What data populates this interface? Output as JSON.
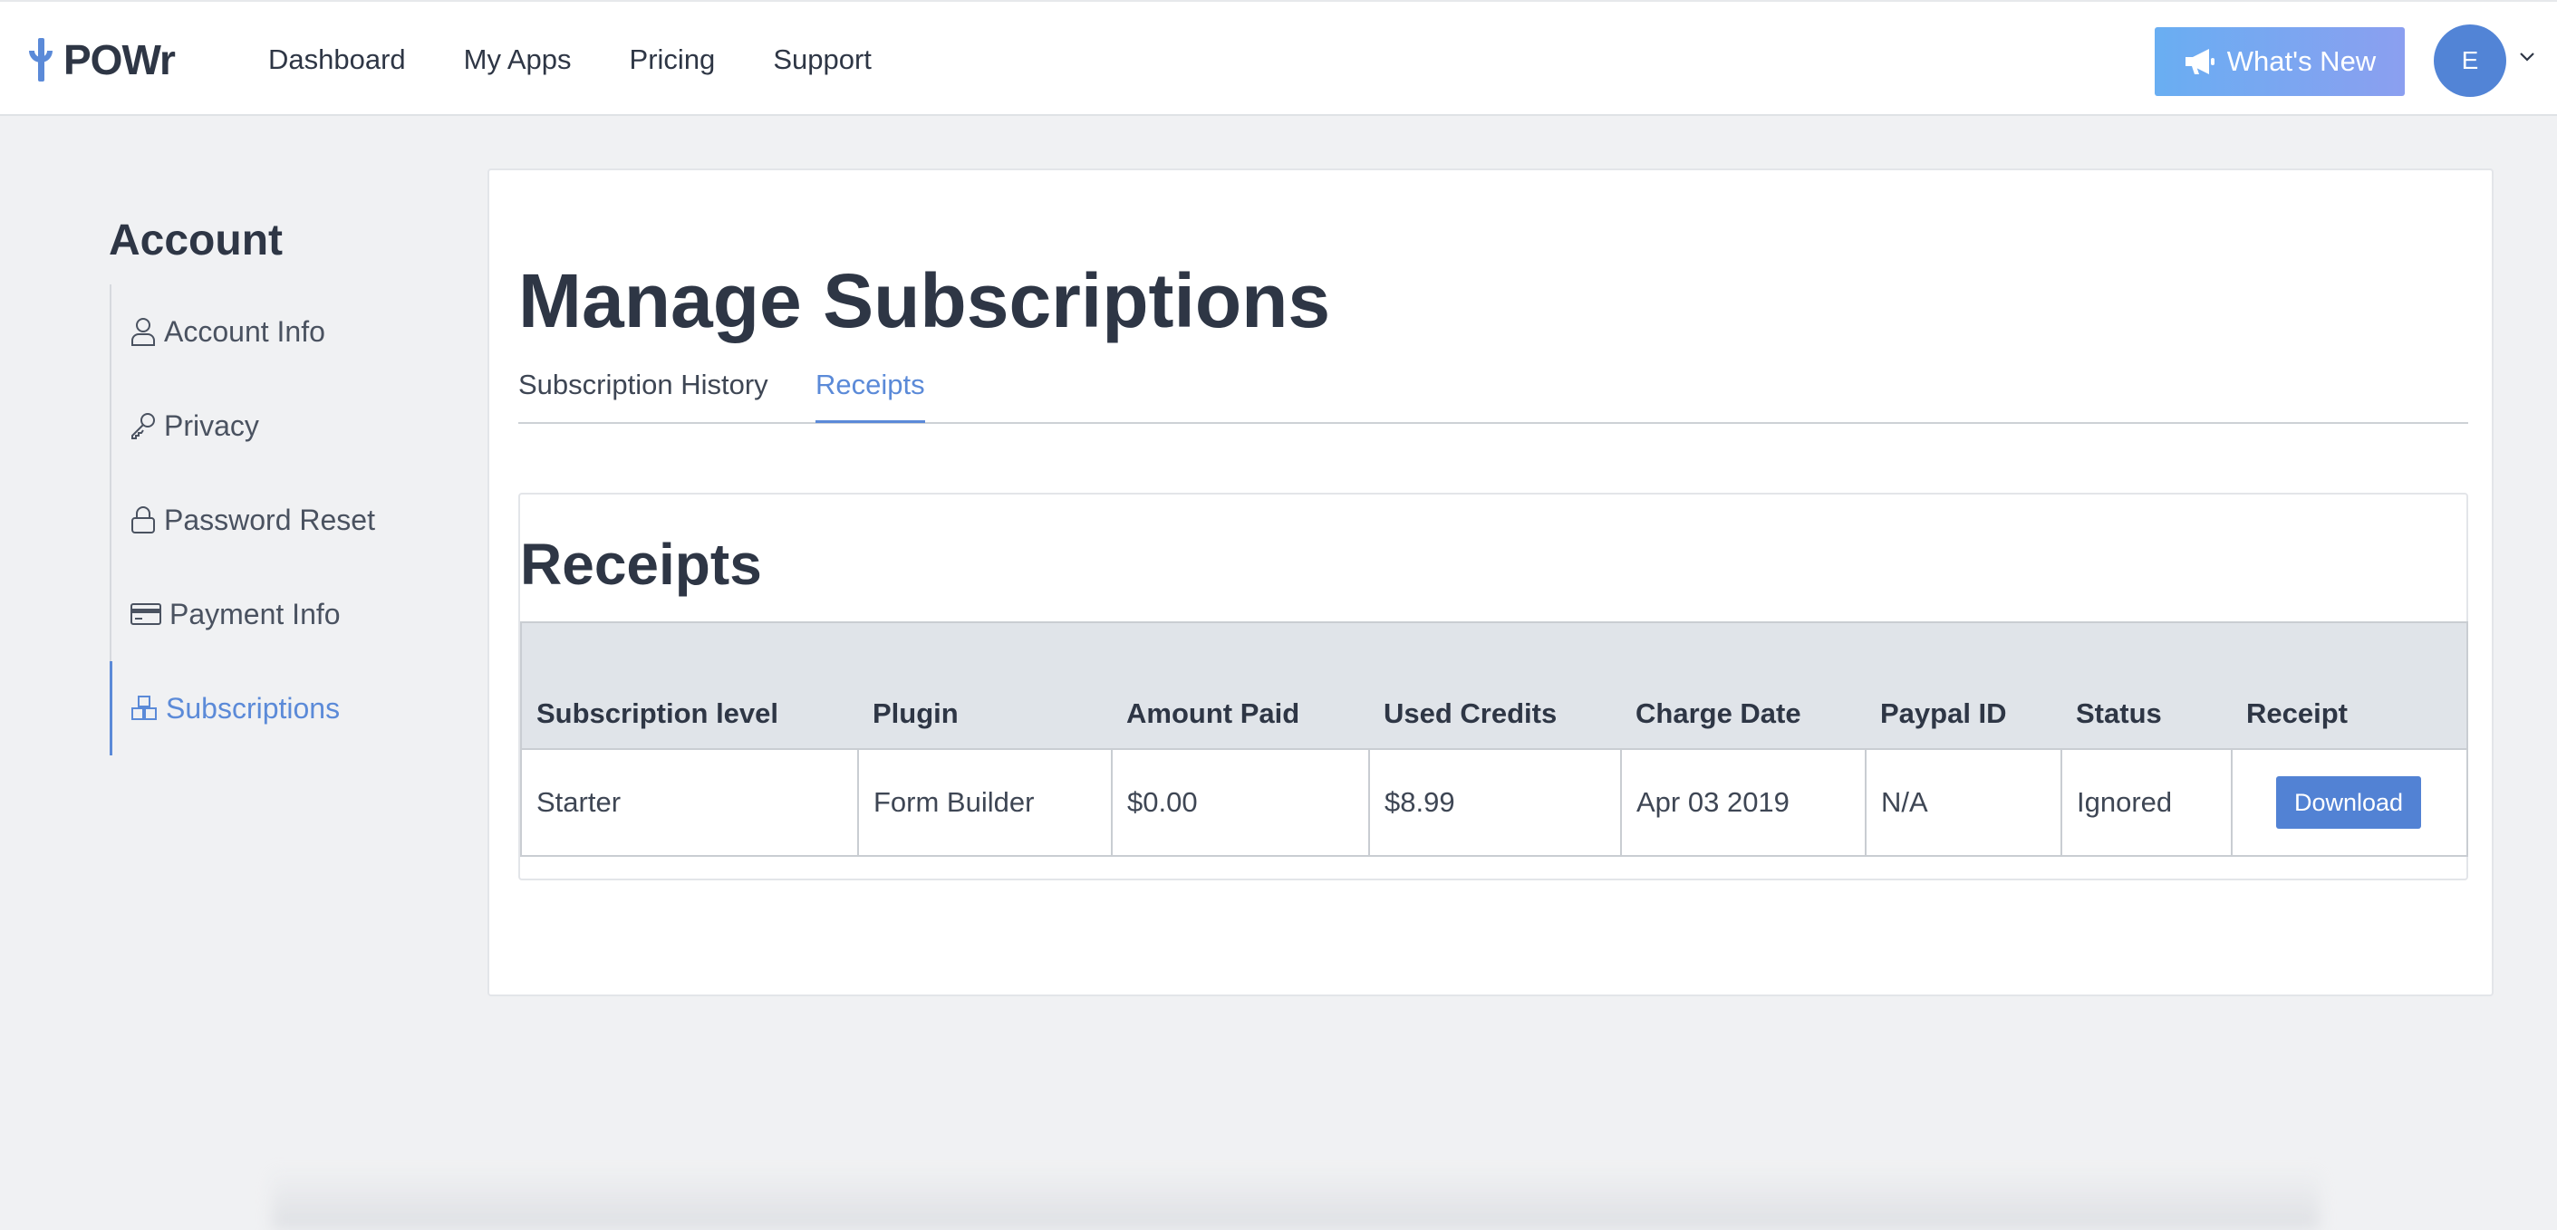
{
  "brand": {
    "name": "POWr"
  },
  "nav": [
    {
      "label": "Dashboard"
    },
    {
      "label": "My Apps"
    },
    {
      "label": "Pricing"
    },
    {
      "label": "Support"
    }
  ],
  "header": {
    "whats_new_label": "What's New",
    "whats_new_icon": "megaphone-icon",
    "avatar_initial": "E"
  },
  "sidebar": {
    "title": "Account",
    "items": [
      {
        "label": "Account Info",
        "icon": "user-icon"
      },
      {
        "label": "Privacy",
        "icon": "key-icon"
      },
      {
        "label": "Password Reset",
        "icon": "lock-icon"
      },
      {
        "label": "Payment Info",
        "icon": "credit-card-icon"
      },
      {
        "label": "Subscriptions",
        "icon": "cubes-icon",
        "active": true
      }
    ]
  },
  "main": {
    "title": "Manage Subscriptions",
    "tabs": [
      {
        "label": "Subscription History"
      },
      {
        "label": "Receipts",
        "active": true
      }
    ],
    "receipts": {
      "title": "Receipts",
      "columns": [
        "Subscription level",
        "Plugin",
        "Amount Paid",
        "Used Credits",
        "Charge Date",
        "Paypal ID",
        "Status",
        "Receipt"
      ],
      "rows": [
        [
          "Starter",
          "Form Builder",
          "$0.00",
          "$8.99",
          "Apr 03 2019",
          "N/A",
          "Ignored",
          "Download"
        ]
      ]
    }
  },
  "colors": {
    "accent": "#5b8ad8",
    "button": "#5282d4",
    "background": "#f0f1f3",
    "table_header": "#e0e4e9"
  }
}
